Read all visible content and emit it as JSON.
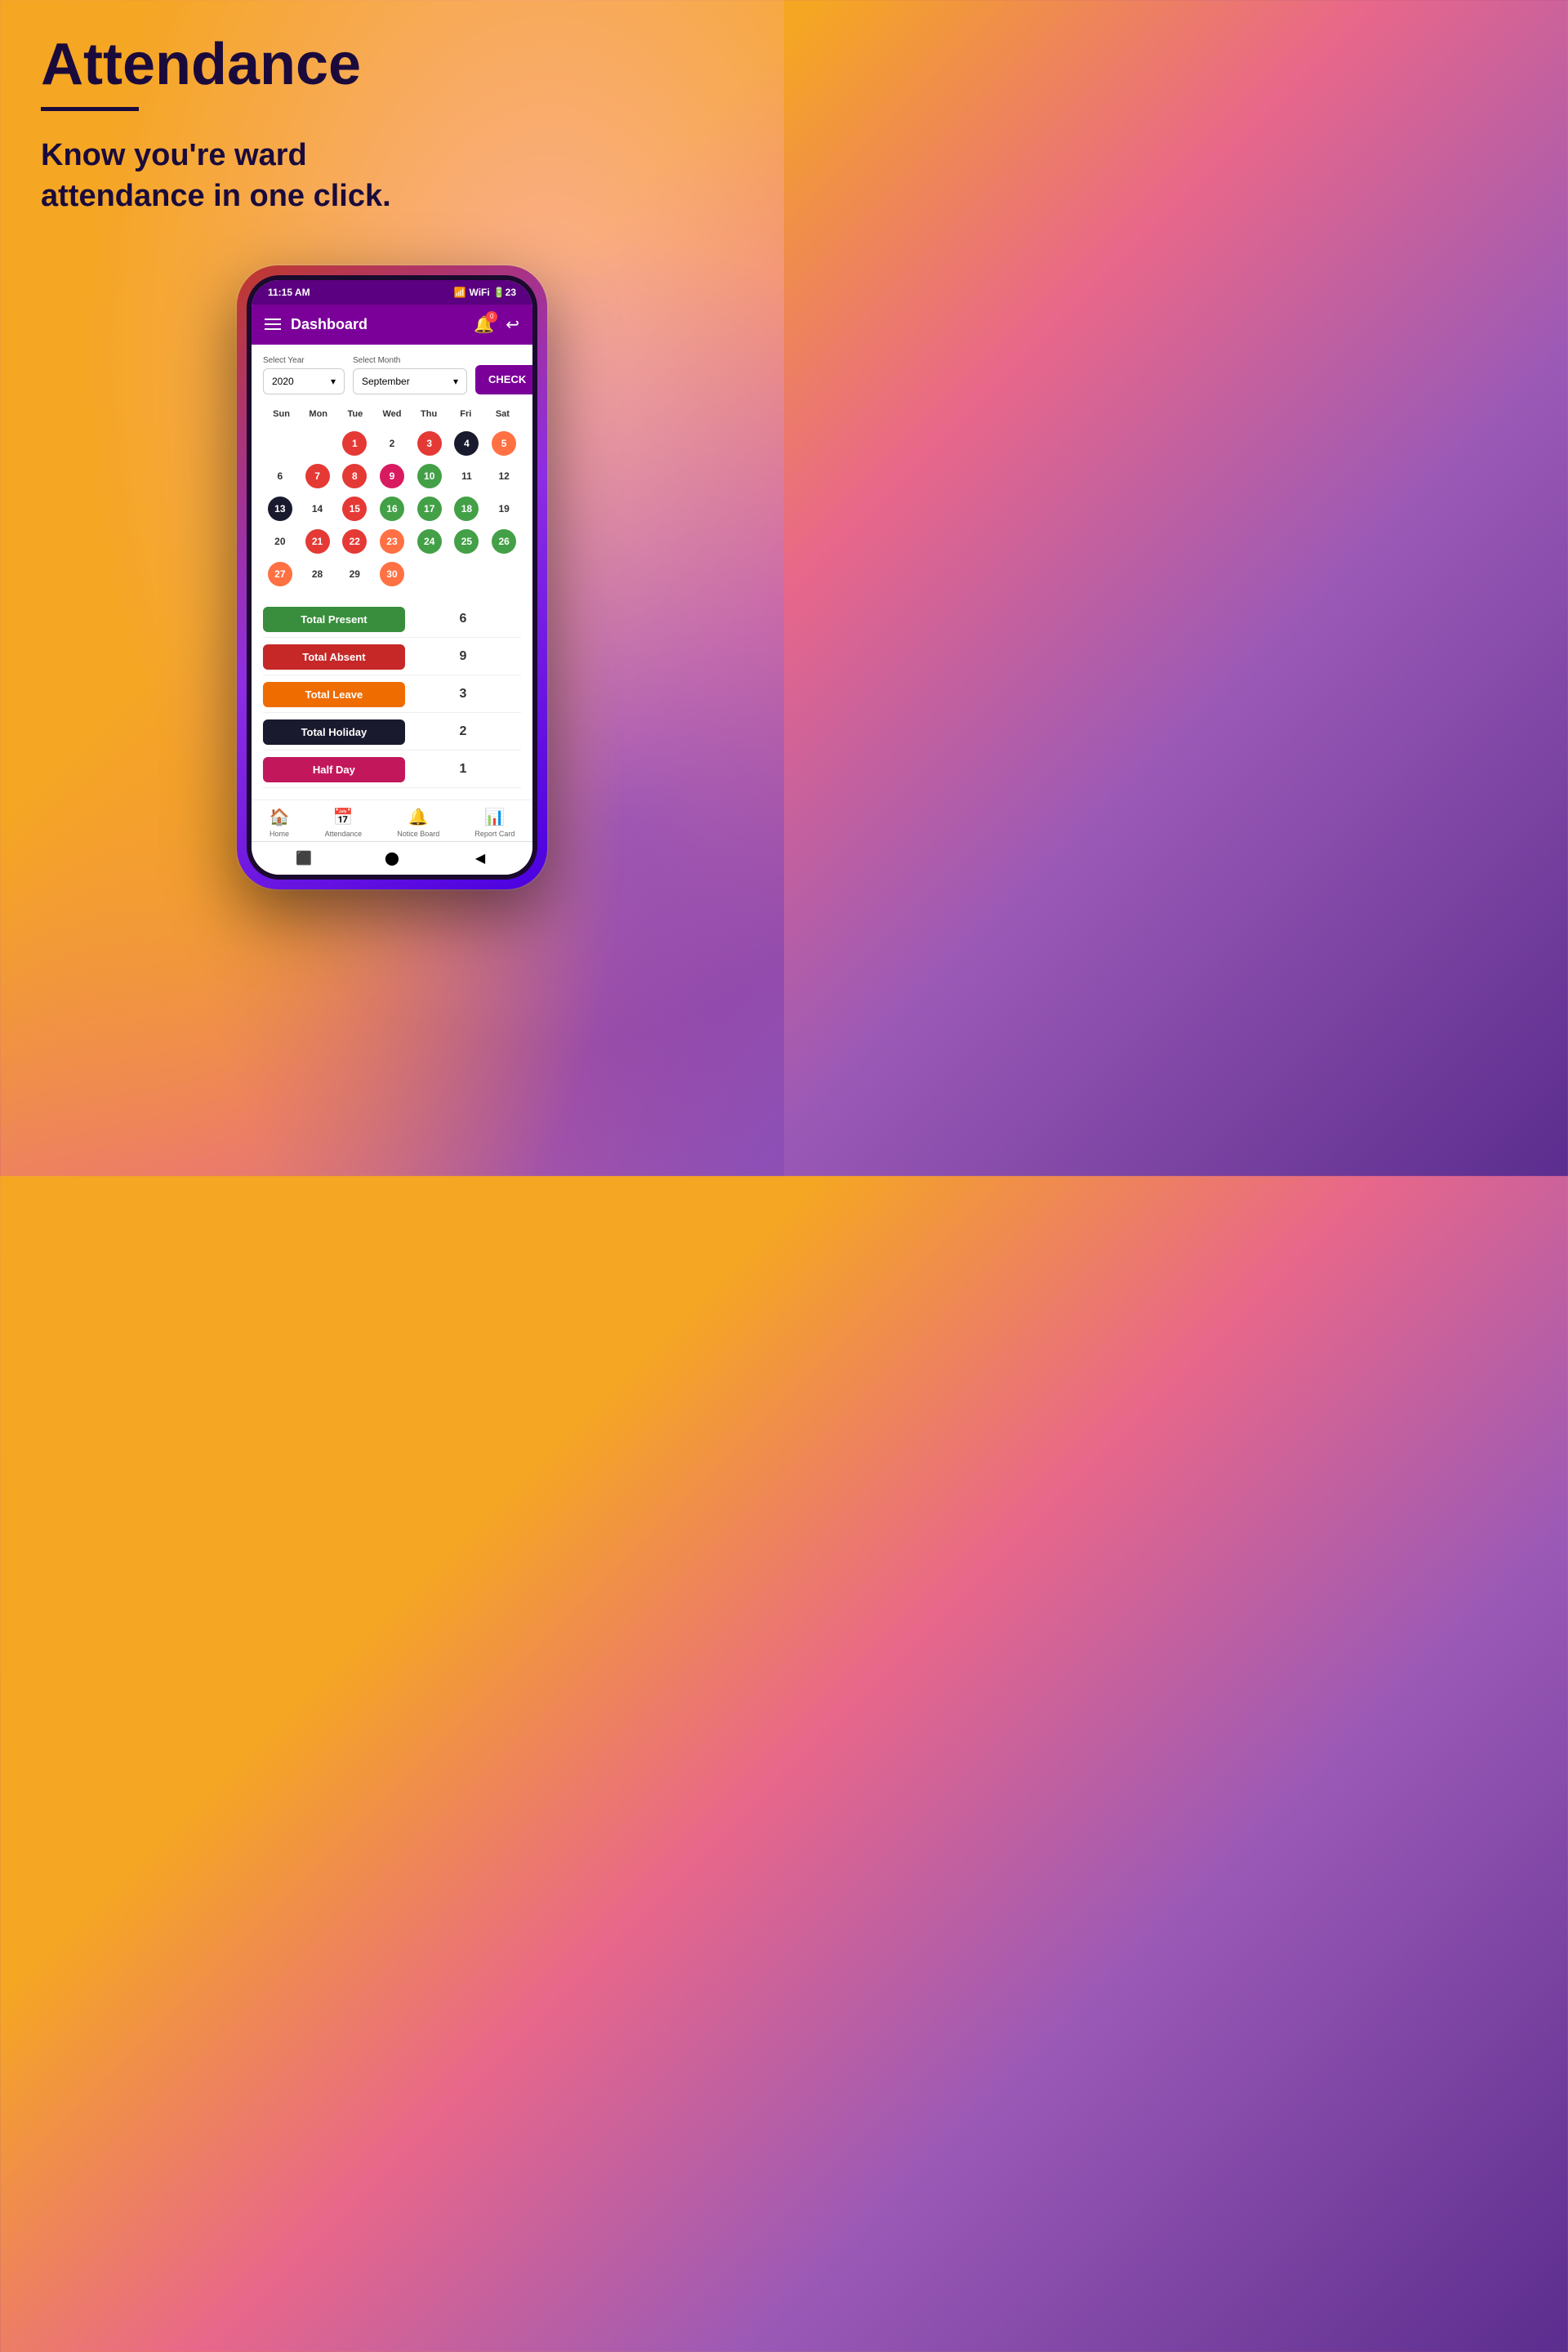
{
  "page": {
    "title": "Attendance",
    "subtitle": "Know you're ward\nattendance in one click.",
    "title_underline": true
  },
  "status_bar": {
    "time": "11:15 AM",
    "signal": "▌▌▌",
    "wifi": "WiFi",
    "battery": "23"
  },
  "header": {
    "title": "Dashboard",
    "notification_badge": "0"
  },
  "controls": {
    "year_label": "Select Year",
    "year_value": "2020",
    "month_label": "Select Month",
    "month_value": "September",
    "check_button": "CHECK"
  },
  "calendar": {
    "day_names": [
      "Sun",
      "Mon",
      "Tue",
      "Wed",
      "Thu",
      "Fri",
      "Sat"
    ],
    "weeks": [
      [
        {
          "day": "",
          "type": "empty"
        },
        {
          "day": "",
          "type": "empty"
        },
        {
          "day": "1",
          "type": "red"
        },
        {
          "day": "2",
          "type": "empty"
        },
        {
          "day": "3",
          "type": "red"
        },
        {
          "day": "4",
          "type": "dark"
        },
        {
          "day": "5",
          "type": "orange"
        }
      ],
      [
        {
          "day": "6",
          "type": "empty"
        },
        {
          "day": "7",
          "type": "red"
        },
        {
          "day": "8",
          "type": "red"
        },
        {
          "day": "9",
          "type": "pink"
        },
        {
          "day": "10",
          "type": "green"
        },
        {
          "day": "11",
          "type": "empty"
        },
        {
          "day": "12",
          "type": "empty"
        }
      ],
      [
        {
          "day": "13",
          "type": "dark"
        },
        {
          "day": "14",
          "type": "empty"
        },
        {
          "day": "15",
          "type": "red"
        },
        {
          "day": "16",
          "type": "green"
        },
        {
          "day": "17",
          "type": "green"
        },
        {
          "day": "18",
          "type": "green"
        },
        {
          "day": "19",
          "type": "empty"
        }
      ],
      [
        {
          "day": "20",
          "type": "empty"
        },
        {
          "day": "21",
          "type": "red"
        },
        {
          "day": "22",
          "type": "red"
        },
        {
          "day": "23",
          "type": "orange"
        },
        {
          "day": "24",
          "type": "green"
        },
        {
          "day": "25",
          "type": "green"
        },
        {
          "day": "26",
          "type": "green"
        }
      ],
      [
        {
          "day": "27",
          "type": "orange"
        },
        {
          "day": "28",
          "type": "empty"
        },
        {
          "day": "29",
          "type": "empty"
        },
        {
          "day": "30",
          "type": "orange"
        },
        {
          "day": "",
          "type": "empty"
        },
        {
          "day": "",
          "type": "empty"
        },
        {
          "day": "",
          "type": "empty"
        }
      ]
    ]
  },
  "stats": [
    {
      "label": "Total Present",
      "value": "6",
      "color_class": "label-green"
    },
    {
      "label": "Total Absent",
      "value": "9",
      "color_class": "label-red"
    },
    {
      "label": "Total Leave",
      "value": "3",
      "color_class": "label-orange"
    },
    {
      "label": "Total Holiday",
      "value": "2",
      "color_class": "label-dark"
    },
    {
      "label": "Half Day",
      "value": "1",
      "color_class": "label-pink"
    }
  ],
  "bottom_nav": [
    {
      "label": "Home",
      "icon": "🏠"
    },
    {
      "label": "Attendance",
      "icon": "📅"
    },
    {
      "label": "Notice Board",
      "icon": "🔔"
    },
    {
      "label": "Report Card",
      "icon": "📊"
    }
  ]
}
